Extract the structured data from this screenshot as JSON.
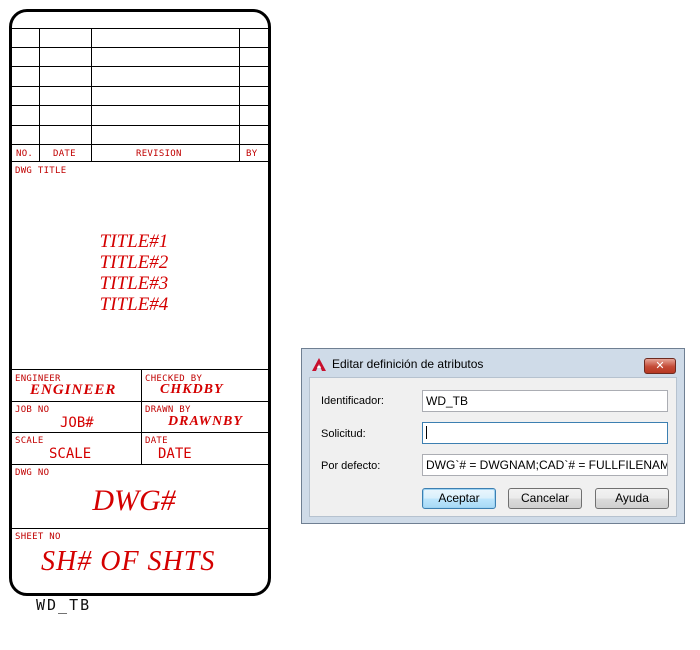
{
  "titleblock": {
    "revision_headers": {
      "no": "NO.",
      "date": "DATE",
      "revision": "REVISION",
      "by": "BY"
    },
    "dwg_title_label": "DWG TITLE",
    "titles": [
      "TITLE#1",
      "TITLE#2",
      "TITLE#3",
      "TITLE#4"
    ],
    "engineer_label": "ENGINEER",
    "engineer_value": "ENGINEER",
    "checked_label": "CHECKED BY",
    "checked_value": "CHKDBY",
    "job_label": "JOB NO",
    "job_value": "JOB#",
    "drawn_label": "DRAWN BY",
    "drawn_value": "DRAWNBY",
    "scale_label": "SCALE",
    "scale_value": "SCALE",
    "date_label": "DATE",
    "date_value": "DATE",
    "dwgno_label": "DWG NO",
    "dwgno_value": "DWG#",
    "sheet_label": "SHEET NO",
    "sheet_value": "SH# OF SHTS",
    "block_name": "WD_TB",
    "line_color": "#000000",
    "text_color": "#d40000"
  },
  "dialog": {
    "title": "Editar definición de atributos",
    "app_icon": "autocad-logo-icon",
    "close_label": "✕",
    "fields": {
      "tag_label": "Identificador:",
      "tag_value": "WD_TB",
      "prompt_label": "Solicitud:",
      "prompt_value": "",
      "default_label": "Por defecto:",
      "default_value": "DWG`# = DWGNAM;CAD`# = FULLFILENAME;SH"
    },
    "buttons": {
      "ok": "Aceptar",
      "cancel": "Cancelar",
      "help": "Ayuda"
    }
  }
}
